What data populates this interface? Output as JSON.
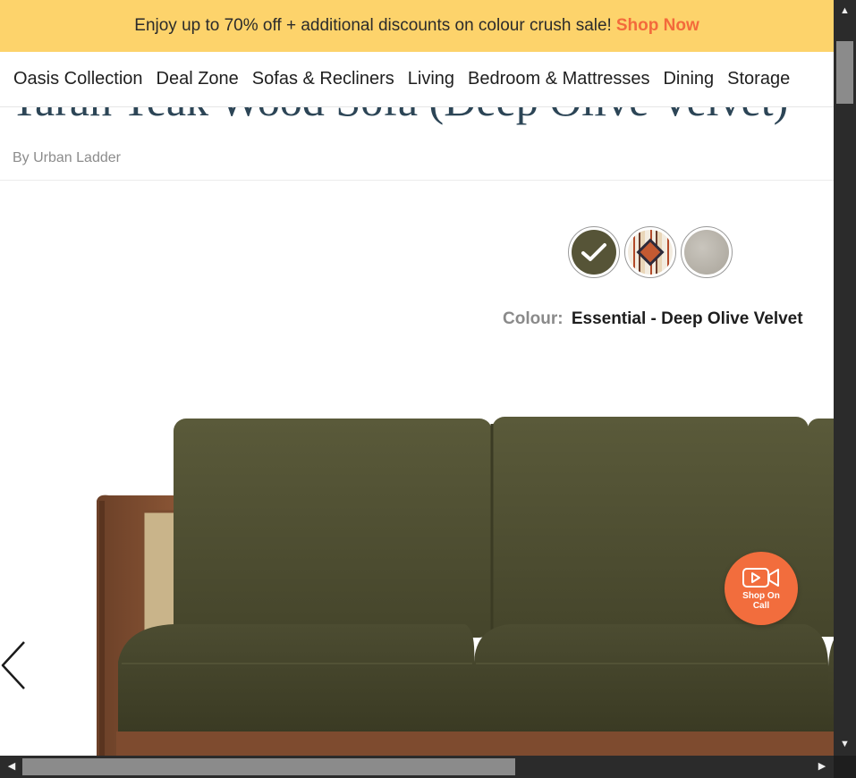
{
  "promo": {
    "text": "Enjoy up to 70% off + additional discounts on colour crush sale!",
    "link": "Shop Now"
  },
  "nav": {
    "items": [
      {
        "label": "Oasis Collection"
      },
      {
        "label": "Deal Zone"
      },
      {
        "label": "Sofas & Recliners"
      },
      {
        "label": "Living"
      },
      {
        "label": "Bedroom & Mattresses"
      },
      {
        "label": "Dining"
      },
      {
        "label": "Storage"
      }
    ]
  },
  "product": {
    "title": "Taran Teak Wood Sofa (Deep Olive Velvet)",
    "brand": "By Urban Ladder",
    "colour_label": "Colour:",
    "colour_value": "Essential - Deep Olive Velvet",
    "swatch_colors": {
      "olive": "#565437",
      "grey": "#b9b5ac"
    }
  },
  "call_button": {
    "label": "Shop On Call"
  },
  "colors": {
    "promo_bg": "#fdd36b",
    "accent": "#f26d3d",
    "title": "#2c4556"
  }
}
